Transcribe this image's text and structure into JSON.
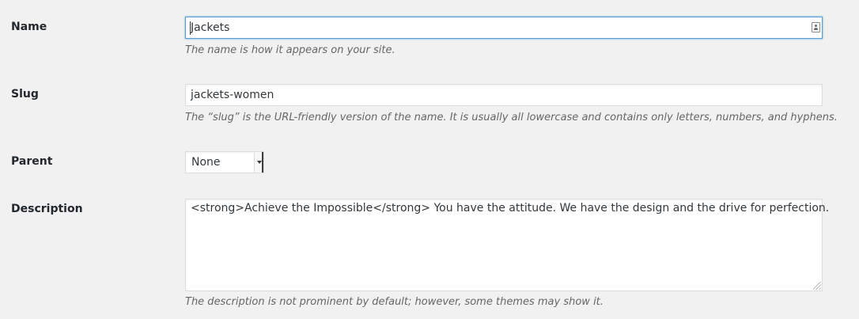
{
  "form": {
    "name": {
      "label": "Name",
      "value": "Jackets",
      "help": "The name is how it appears on your site."
    },
    "slug": {
      "label": "Slug",
      "value": "jackets-women",
      "help": "The “slug” is the URL-friendly version of the name. It is usually all lowercase and contains only letters, numbers, and hyphens."
    },
    "parent": {
      "label": "Parent",
      "selected": "None"
    },
    "description": {
      "label": "Description",
      "value": "<strong>Achieve the Impossible</strong> You have the attitude. We have the design and the drive for perfection.",
      "help": "The description is not prominent by default; however, some themes may show it."
    }
  },
  "icons": {
    "name_field_icon": "contact-card-icon",
    "select_icon": "dropdown-arrow-icon",
    "textarea_icon": "resize-handle-icon"
  },
  "colors": {
    "background": "#f1f1f1",
    "focus_border": "#5b9dd9",
    "input_border": "#dddddd",
    "help_text": "#666666"
  }
}
